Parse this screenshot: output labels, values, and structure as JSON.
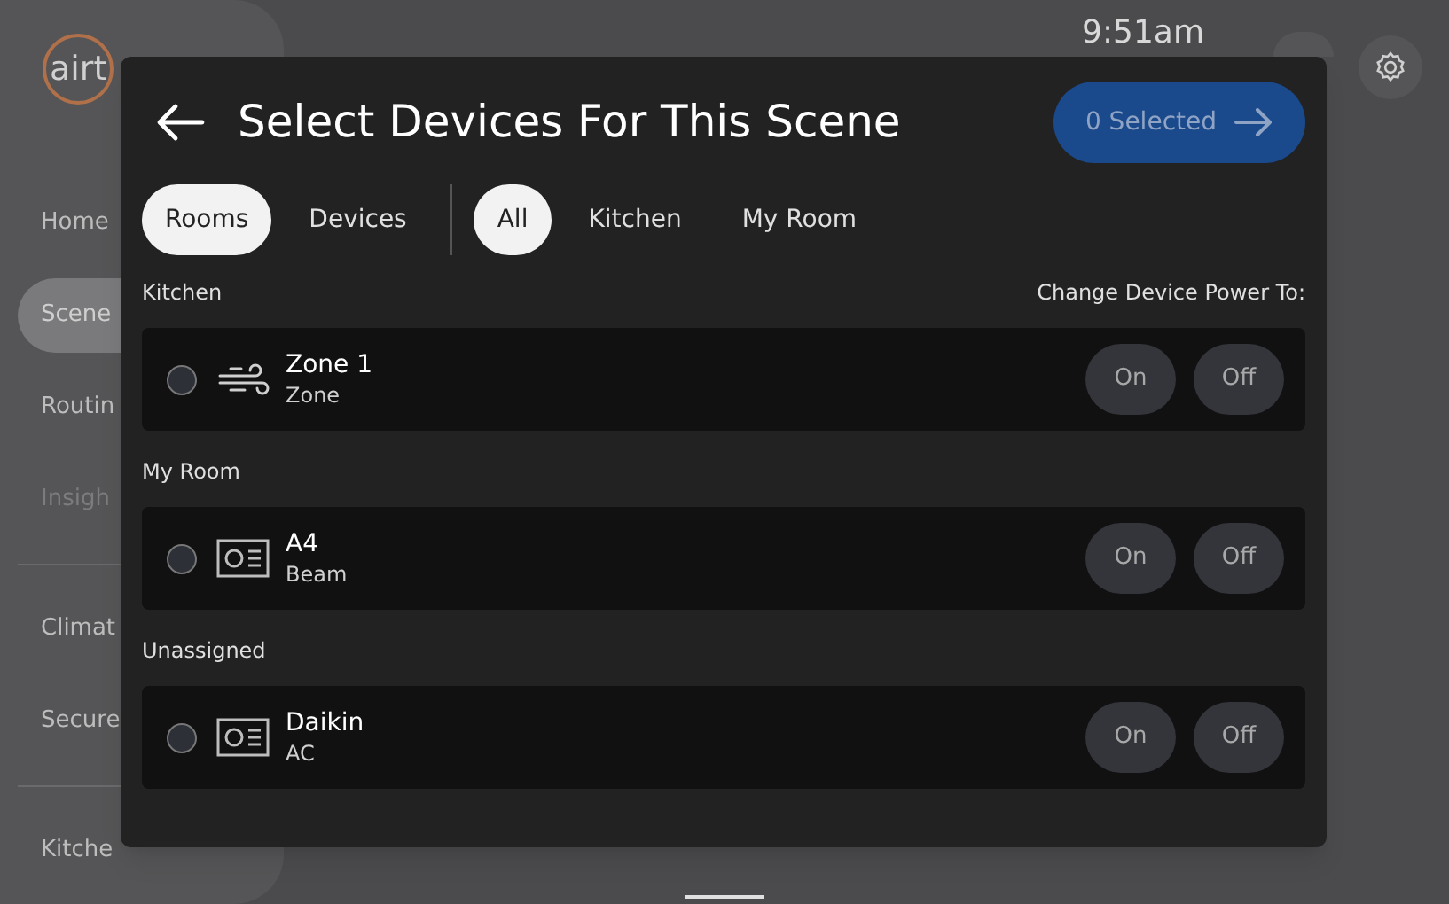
{
  "app": {
    "logo": "airt",
    "time": "9:51am",
    "nav": [
      {
        "label": "Home",
        "selected": false
      },
      {
        "label": "Scene",
        "selected": true
      },
      {
        "label": "Routin",
        "selected": false
      },
      {
        "label": "Insigh",
        "selected": false,
        "disabled": true
      },
      {
        "label": "Climat",
        "selected": false
      },
      {
        "label": "Secure",
        "selected": false
      },
      {
        "label": "Kitche",
        "selected": false
      }
    ]
  },
  "dialog": {
    "title": "Select Devices For This Scene",
    "next_button": "0 Selected",
    "group_by": [
      {
        "label": "Rooms",
        "selected": true
      },
      {
        "label": "Devices",
        "selected": false
      }
    ],
    "room_filter": [
      {
        "label": "All",
        "selected": true
      },
      {
        "label": "Kitchen",
        "selected": false
      },
      {
        "label": "My Room",
        "selected": false
      }
    ],
    "power_label": "Change Device Power To:",
    "sections": [
      {
        "room": "Kitchen",
        "devices": [
          {
            "name": "Zone 1",
            "type": "Zone",
            "kind": "zone",
            "checked": false,
            "on": "On",
            "off": "Off"
          }
        ]
      },
      {
        "room": "My Room",
        "devices": [
          {
            "name": "A4",
            "type": "Beam",
            "kind": "unit",
            "checked": false,
            "on": "On",
            "off": "Off"
          }
        ]
      },
      {
        "room": "Unassigned",
        "devices": [
          {
            "name": "Daikin",
            "type": "AC",
            "kind": "unit",
            "checked": false,
            "on": "On",
            "off": "Off"
          }
        ]
      }
    ]
  }
}
